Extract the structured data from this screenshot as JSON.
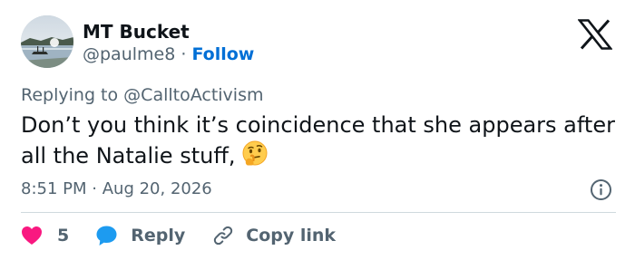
{
  "author": {
    "name": "MT Bucket",
    "handle": "@paulme8",
    "separator": "·",
    "follow_label": "Follow"
  },
  "reply_to": {
    "prefix": "Replying to",
    "handle": "@CalltoActivism"
  },
  "tweet": {
    "text": "Don’t you think it’s coincidence that she appears after all the Natalie stuff,",
    "emoji": "thinking-face-icon"
  },
  "meta": {
    "time": "8:51 PM",
    "separator": "·",
    "date": "Aug 20, 2026"
  },
  "actions": {
    "like_count": "5",
    "reply_label": "Reply",
    "copy_link_label": "Copy link"
  },
  "colors": {
    "heart": "#f91880",
    "reply_bubble": "#1d9bf0",
    "link": "#006fd6",
    "muted": "#536471",
    "text": "#0f1419",
    "divider": "#cfd9de"
  },
  "icons": [
    "x-logo-icon",
    "info-icon",
    "heart-icon",
    "reply-bubble-icon",
    "link-icon",
    "thinking-face-icon"
  ]
}
